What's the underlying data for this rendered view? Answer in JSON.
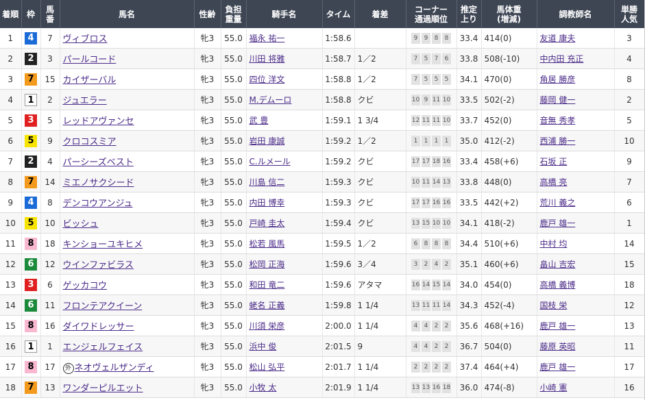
{
  "colors": {
    "header_bg": "#3e4654",
    "link": "#4a2a88",
    "waku": {
      "1": "#ffffff",
      "2": "#222222",
      "3": "#e02020",
      "4": "#1a6ad8",
      "5": "#f7e400",
      "6": "#1b8a3a",
      "7": "#f39a1d",
      "8": "#f9b8cf"
    }
  },
  "headers": {
    "rank": "着順",
    "waku": "枠",
    "umaban_1": "馬",
    "umaban_2": "番",
    "horse": "馬名",
    "sexage": "性齢",
    "weight_1": "負担",
    "weight_2": "重量",
    "jockey": "騎手名",
    "time": "タイム",
    "margin": "着差",
    "corner_1": "コーナー",
    "corner_2": "通過順位",
    "agari_1": "推定",
    "agari_2": "上り",
    "bodyweight_1": "馬体重",
    "bodyweight_2": "(増減)",
    "trainer": "調教師名",
    "pop_1": "単勝",
    "pop_2": "人気"
  },
  "rows": [
    {
      "rank": "1",
      "waku": "4",
      "umaban": "7",
      "horse": "ヴィブロス",
      "gaikoku": "",
      "sexage": "牝3",
      "weight": "55.0",
      "jockey": "福永 祐一",
      "time": "1:58.6",
      "margin": "",
      "corner": [
        "9",
        "9",
        "8",
        "8"
      ],
      "agari": "33.4",
      "bodyweight": "414(0)",
      "trainer": "友道 康夫",
      "pop": "3"
    },
    {
      "rank": "2",
      "waku": "2",
      "umaban": "3",
      "horse": "パールコード",
      "gaikoku": "",
      "sexage": "牝3",
      "weight": "55.0",
      "jockey": "川田 将雅",
      "time": "1:58.7",
      "margin": "1／2",
      "corner": [
        "7",
        "5",
        "7",
        "6"
      ],
      "agari": "33.8",
      "bodyweight": "508(-10)",
      "trainer": "中内田 充正",
      "pop": "4"
    },
    {
      "rank": "3",
      "waku": "7",
      "umaban": "15",
      "horse": "カイザーバル",
      "gaikoku": "",
      "sexage": "牝3",
      "weight": "55.0",
      "jockey": "四位 洋文",
      "time": "1:58.8",
      "margin": "1／2",
      "corner": [
        "7",
        "5",
        "5",
        "5"
      ],
      "agari": "34.1",
      "bodyweight": "470(0)",
      "trainer": "角居 勝彦",
      "pop": "8"
    },
    {
      "rank": "4",
      "waku": "1",
      "umaban": "2",
      "horse": "ジュエラー",
      "gaikoku": "",
      "sexage": "牝3",
      "weight": "55.0",
      "jockey": "M.デムーロ",
      "time": "1:58.8",
      "margin": "クビ",
      "corner": [
        "10",
        "9",
        "11",
        "10"
      ],
      "agari": "33.5",
      "bodyweight": "502(-2)",
      "trainer": "藤岡 健一",
      "pop": "2"
    },
    {
      "rank": "5",
      "waku": "3",
      "umaban": "5",
      "horse": "レッドアヴァンセ",
      "gaikoku": "",
      "sexage": "牝3",
      "weight": "55.0",
      "jockey": "武 豊",
      "time": "1:59.1",
      "margin": "1 3/4",
      "corner": [
        "12",
        "11",
        "11",
        "10"
      ],
      "agari": "33.7",
      "bodyweight": "452(0)",
      "trainer": "音無 秀孝",
      "pop": "5"
    },
    {
      "rank": "6",
      "waku": "5",
      "umaban": "9",
      "horse": "クロコスミア",
      "gaikoku": "",
      "sexage": "牝3",
      "weight": "55.0",
      "jockey": "岩田 康誠",
      "time": "1:59.2",
      "margin": "1／2",
      "corner": [
        "1",
        "1",
        "1",
        "1"
      ],
      "agari": "35.0",
      "bodyweight": "412(-2)",
      "trainer": "西浦 勝一",
      "pop": "10"
    },
    {
      "rank": "7",
      "waku": "2",
      "umaban": "4",
      "horse": "パーシーズベスト",
      "gaikoku": "",
      "sexage": "牝3",
      "weight": "55.0",
      "jockey": "C.ルメール",
      "time": "1:59.2",
      "margin": "クビ",
      "corner": [
        "17",
        "17",
        "18",
        "16"
      ],
      "agari": "33.4",
      "bodyweight": "458(+6)",
      "trainer": "石坂 正",
      "pop": "9"
    },
    {
      "rank": "8",
      "waku": "7",
      "umaban": "14",
      "horse": "ミエノサクシード",
      "gaikoku": "",
      "sexage": "牝3",
      "weight": "55.0",
      "jockey": "川島 信二",
      "time": "1:59.3",
      "margin": "クビ",
      "corner": [
        "10",
        "11",
        "14",
        "13"
      ],
      "agari": "33.8",
      "bodyweight": "448(0)",
      "trainer": "高橋 亮",
      "pop": "7"
    },
    {
      "rank": "9",
      "waku": "4",
      "umaban": "8",
      "horse": "デンコウアンジュ",
      "gaikoku": "",
      "sexage": "牝3",
      "weight": "55.0",
      "jockey": "内田 博幸",
      "time": "1:59.3",
      "margin": "クビ",
      "corner": [
        "17",
        "17",
        "16",
        "16"
      ],
      "agari": "33.5",
      "bodyweight": "442(+2)",
      "trainer": "荒川 義之",
      "pop": "6"
    },
    {
      "rank": "10",
      "waku": "5",
      "umaban": "10",
      "horse": "ビッシュ",
      "gaikoku": "",
      "sexage": "牝3",
      "weight": "55.0",
      "jockey": "戸崎 圭太",
      "time": "1:59.4",
      "margin": "クビ",
      "corner": [
        "13",
        "15",
        "10",
        "10"
      ],
      "agari": "34.1",
      "bodyweight": "418(-2)",
      "trainer": "鹿戸 雄一",
      "pop": "1"
    },
    {
      "rank": "11",
      "waku": "8",
      "umaban": "18",
      "horse": "キンショーユキヒメ",
      "gaikoku": "",
      "sexage": "牝3",
      "weight": "55.0",
      "jockey": "松若 風馬",
      "time": "1:59.5",
      "margin": "1／2",
      "corner": [
        "6",
        "8",
        "8",
        "8"
      ],
      "agari": "34.4",
      "bodyweight": "510(+6)",
      "trainer": "中村 均",
      "pop": "14"
    },
    {
      "rank": "12",
      "waku": "6",
      "umaban": "12",
      "horse": "ウインファビラス",
      "gaikoku": "",
      "sexage": "牝3",
      "weight": "55.0",
      "jockey": "松岡 正海",
      "time": "1:59.6",
      "margin": "3／4",
      "corner": [
        "3",
        "2",
        "4",
        "2"
      ],
      "agari": "35.1",
      "bodyweight": "460(+6)",
      "trainer": "畠山 吉宏",
      "pop": "15"
    },
    {
      "rank": "13",
      "waku": "3",
      "umaban": "6",
      "horse": "ゲッカコウ",
      "gaikoku": "",
      "sexage": "牝3",
      "weight": "55.0",
      "jockey": "和田 竜二",
      "time": "1:59.6",
      "margin": "アタマ",
      "corner": [
        "16",
        "14",
        "15",
        "14"
      ],
      "agari": "34.0",
      "bodyweight": "454(0)",
      "trainer": "高橋 義博",
      "pop": "18"
    },
    {
      "rank": "14",
      "waku": "6",
      "umaban": "11",
      "horse": "フロンテアクイーン",
      "gaikoku": "",
      "sexage": "牝3",
      "weight": "55.0",
      "jockey": "蛯名 正義",
      "time": "1:59.8",
      "margin": "1 1/4",
      "corner": [
        "13",
        "11",
        "11",
        "14"
      ],
      "agari": "34.3",
      "bodyweight": "452(-4)",
      "trainer": "国枝 栄",
      "pop": "12"
    },
    {
      "rank": "15",
      "waku": "8",
      "umaban": "16",
      "horse": "ダイワドレッサー",
      "gaikoku": "",
      "sexage": "牝3",
      "weight": "55.0",
      "jockey": "川須 栄彦",
      "time": "2:00.0",
      "margin": "1 1/4",
      "corner": [
        "4",
        "4",
        "2",
        "2"
      ],
      "agari": "35.6",
      "bodyweight": "468(+16)",
      "trainer": "鹿戸 雄一",
      "pop": "13"
    },
    {
      "rank": "16",
      "waku": "1",
      "umaban": "1",
      "horse": "エンジェルフェイス",
      "gaikoku": "",
      "sexage": "牝3",
      "weight": "55.0",
      "jockey": "浜中 俊",
      "time": "2:01.5",
      "margin": "9",
      "corner": [
        "4",
        "4",
        "2",
        "2"
      ],
      "agari": "36.7",
      "bodyweight": "504(0)",
      "trainer": "藤原 英昭",
      "pop": "11"
    },
    {
      "rank": "17",
      "waku": "8",
      "umaban": "17",
      "horse": "ネオヴェルザンディ",
      "gaikoku": "外",
      "sexage": "牝3",
      "weight": "55.0",
      "jockey": "松山 弘平",
      "time": "2:01.7",
      "margin": "1 1/4",
      "corner": [
        "2",
        "2",
        "2",
        "2"
      ],
      "agari": "37.4",
      "bodyweight": "464(+4)",
      "trainer": "鹿戸 雄一",
      "pop": "17"
    },
    {
      "rank": "18",
      "waku": "7",
      "umaban": "13",
      "horse": "ワンダーピルエット",
      "gaikoku": "",
      "sexage": "牝3",
      "weight": "55.0",
      "jockey": "小牧 太",
      "time": "2:01.9",
      "margin": "1 1/4",
      "corner": [
        "13",
        "13",
        "16",
        "18"
      ],
      "agari": "36.0",
      "bodyweight": "474(-8)",
      "trainer": "小崎 憲",
      "pop": "16"
    }
  ]
}
